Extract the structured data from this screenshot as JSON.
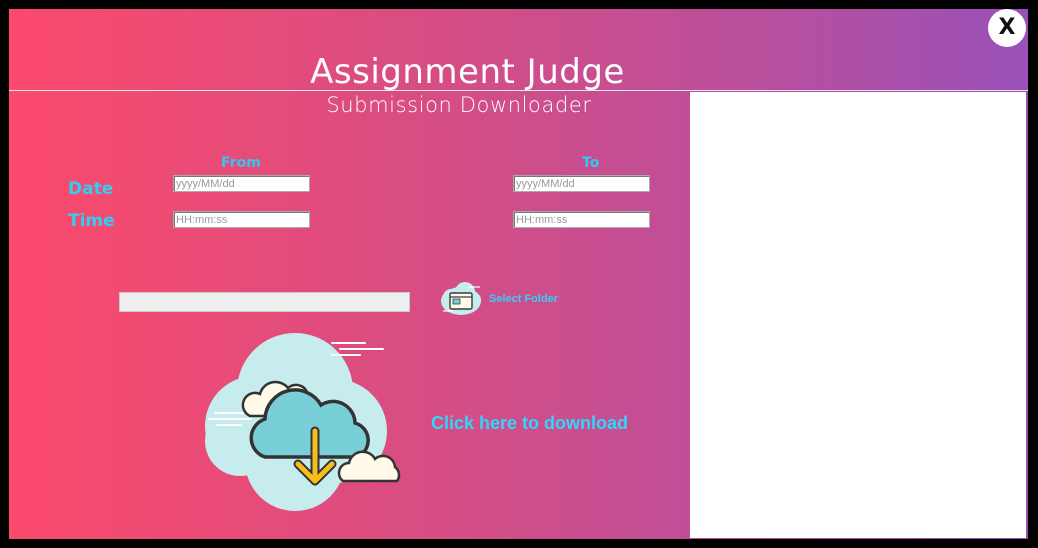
{
  "window": {
    "title": "Assignment Judge",
    "close_label": "X"
  },
  "downloader": {
    "subtitle": "Submission Downloader",
    "from_label": "From",
    "to_label": "To",
    "date_label": "Date",
    "time_label": "Time",
    "from_date": {
      "value": "",
      "placeholder": "yyyy/MM/dd"
    },
    "from_time": {
      "value": "",
      "placeholder": "HH:mm:ss"
    },
    "to_date": {
      "value": "",
      "placeholder": "yyyy/MM/dd"
    },
    "to_time": {
      "value": "",
      "placeholder": "HH:mm:ss"
    },
    "folder_path": "",
    "select_folder_label": "Select Folder",
    "select_folder_icon": "folder-cloud-icon",
    "download_icon": "cloud-download-icon",
    "download_label": "Click here to download"
  },
  "colors": {
    "gradient_start": "#fb4a6c",
    "gradient_end": "#9951b8",
    "accent_text": "#33cdf4",
    "panel": "#ffffff"
  }
}
